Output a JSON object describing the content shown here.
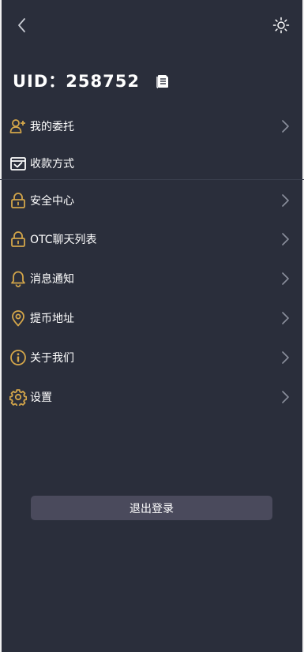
{
  "header": {
    "back_icon": "chevron-left-icon",
    "theme_icon": "sun-icon"
  },
  "profile": {
    "uid_text": "UID：258752",
    "copy_icon": "copy-icon"
  },
  "menu": [
    {
      "id": "my-orders",
      "label": "我的委托",
      "icon": "user-plus-icon",
      "chevron": true
    },
    {
      "id": "payment-methods",
      "label": "收款方式",
      "icon": "card-check-icon",
      "chevron": false
    },
    {
      "id": "security-center",
      "label": "安全中心",
      "icon": "lock-icon",
      "chevron": true
    },
    {
      "id": "otc-chat-list",
      "label": "OTC聊天列表",
      "icon": "lock-icon",
      "chevron": true
    },
    {
      "id": "notifications",
      "label": "消息通知",
      "icon": "bell-icon",
      "chevron": true
    },
    {
      "id": "withdraw-address",
      "label": "提币地址",
      "icon": "location-pin-icon",
      "chevron": true
    },
    {
      "id": "about-us",
      "label": "关于我们",
      "icon": "info-icon",
      "chevron": true
    },
    {
      "id": "settings",
      "label": "设置",
      "icon": "gear-icon",
      "chevron": true
    }
  ],
  "logout_label": "退出登录",
  "colors": {
    "background": "#2a2e3b",
    "accent_gold": "#d4a64a",
    "text": "#ffffff",
    "muted": "#8a8f9c",
    "button": "#4a4a5c"
  }
}
